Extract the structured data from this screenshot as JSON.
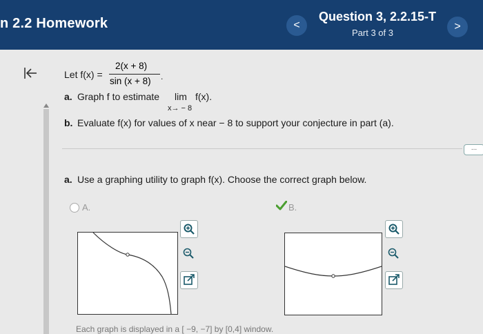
{
  "header": {
    "assignment_title": "n 2.2 Homework",
    "question_title": "Question 3, 2.2.15-T",
    "part_label": "Part 3 of 3",
    "prev_symbol": "<",
    "next_symbol": ">"
  },
  "problem": {
    "let_text": "Let f(x) =",
    "numerator": "2(x + 8)",
    "denominator": "sin (x + 8)",
    "denominator_suffix": ".",
    "part_a_prefix": "a.",
    "part_a_text": "Graph f to estimate",
    "limit_word": "lim",
    "limit_func": "f(x).",
    "limit_sub": "x→ − 8",
    "part_b_prefix": "b.",
    "part_b_text": "Evaluate f(x) for values of x near  − 8 to support your conjecture in part (a)."
  },
  "more_button": "...",
  "question": {
    "prefix": "a.",
    "text": "Use a graphing utility to graph f(x). Choose the correct graph below."
  },
  "options": [
    {
      "label": "A.",
      "selected": false
    },
    {
      "label": "B.",
      "selected": true
    }
  ],
  "footer": "Each graph is displayed in a [ −9, −7] by [0,4] window.",
  "colors": {
    "header": "#163f70",
    "check": "#4a9e2f"
  }
}
